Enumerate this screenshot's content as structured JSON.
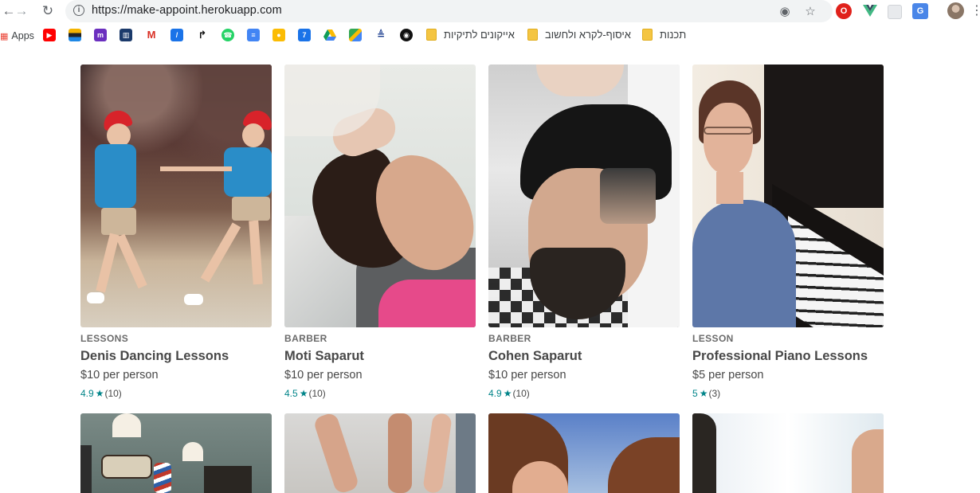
{
  "browser": {
    "url": "https://make-appoint.herokuapp.com",
    "back_icon": "arrow-left-icon",
    "forward_icon": "arrow-right-icon",
    "reload_icon": "reload-icon"
  },
  "bookmarks": {
    "apps_label": "Apps",
    "folders": [
      "איסוף-לקרא ולחשוב",
      "אייקונים לתיקיות",
      "תכנות"
    ],
    "icons": [
      "youtube-icon",
      "ynet-icon",
      "twitch-icon",
      "trello-icon",
      "gmail-icon",
      "app-icon",
      "google-play-icon",
      "whatsapp-icon",
      "google-docs-icon",
      "google-keep-icon",
      "calendar-icon",
      "google-drive-icon",
      "google-maps-icon",
      "israel-railways-icon",
      "github-icon"
    ]
  },
  "cards": [
    {
      "category": "LESSONS",
      "title": "Denis Dancing Lessons",
      "price": "$10 per person",
      "rating": "4.9",
      "reviews": "(10)"
    },
    {
      "category": "BARBER",
      "title": "Moti Saparut",
      "price": "$10 per person",
      "rating": "4.5",
      "reviews": "(10)"
    },
    {
      "category": "BARBER",
      "title": "Cohen Saparut",
      "price": "$10 per person",
      "rating": "4.9",
      "reviews": "(10)"
    },
    {
      "category": "LESSON",
      "title": "Professional Piano Lessons",
      "price": "$5 per person",
      "rating": "5",
      "reviews": "(3)"
    }
  ],
  "colors": {
    "accent": "#008489",
    "text": "#484848",
    "category": "#6b6b6b"
  }
}
